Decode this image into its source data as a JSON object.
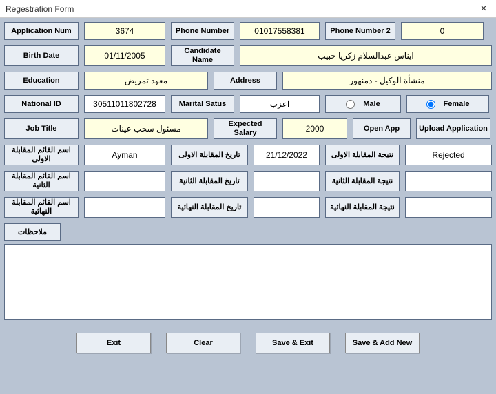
{
  "window": {
    "title": "Regestration Form"
  },
  "labels": {
    "app_num": "Application Num",
    "phone": "Phone Number",
    "phone2": "Phone Number 2",
    "birth": "Birth Date",
    "cand_name": "Candidate Name",
    "education": "Education",
    "address": "Address",
    "national_id": "National ID",
    "marital": "Marital Satus",
    "male": "Male",
    "female": "Female",
    "job_title": "Job Title",
    "exp_salary": "Expected Salary",
    "open_app": "Open App",
    "upload_app": "Upload Application",
    "int1_name": "اسم القائم المقابلة الاولى",
    "int1_date": "تاريخ المقابلة الاولى",
    "int1_result": "نتيجة المقابلة الاولى",
    "int2_name": "اسم القائم المقابلة الثانية",
    "int2_date": "تاريخ المقابلة الثانية",
    "int2_result": "نتيجة المقابلة الثانية",
    "intf_name": "اسم القائم المقابلة النهائية",
    "intf_date": "تاريخ المقابلة النهائية",
    "intf_result": "نتيجة المقابلة النهائية",
    "notes": "ملاحظات"
  },
  "values": {
    "app_num": "3674",
    "phone": "01017558381",
    "phone2": "0",
    "birth": "01/11/2005",
    "cand_name": "ايناس عبدالسلام زكريا حبيب",
    "education": "معهد تمريض",
    "address": "منشأة الوكيل - دمنهور",
    "national_id": "30511011802728",
    "marital": "اعزب",
    "gender": "female",
    "job_title": "مسئول سحب عينات",
    "exp_salary": "2000",
    "int1_name": "Ayman",
    "int1_date": "21/12/2022",
    "int1_result": "Rejected",
    "int2_name": "",
    "int2_date": "",
    "int2_result": "",
    "intf_name": "",
    "intf_date": "",
    "intf_result": "",
    "notes": ""
  },
  "buttons": {
    "exit": "Exit",
    "clear": "Clear",
    "save_exit": "Save & Exit",
    "save_add": "Save & Add New"
  }
}
